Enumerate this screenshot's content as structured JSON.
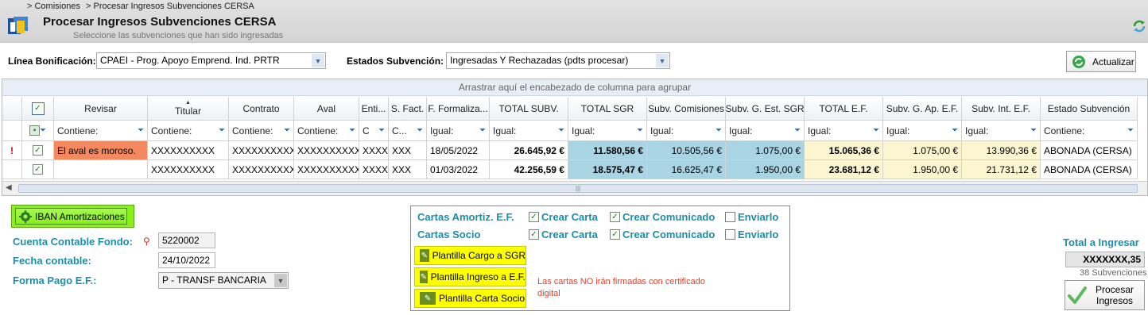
{
  "breadcrumb": {
    "item1": "> Comisiones",
    "item2": "> Procesar Ingresos Subvenciones CERSA"
  },
  "page": {
    "title": "Procesar Ingresos Subvenciones CERSA",
    "subtitle": "Seleccione las subvenciones que han sido ingresadas"
  },
  "filters": {
    "linea_label": "Línea Bonificación:",
    "linea_value": "CPAEI - Prog. Apoyo Emprend. Ind. PRTR",
    "estados_label": "Estados Subvención:",
    "estados_value": "Ingresadas Y Rechazadas (pdts procesar)",
    "actualizar_label": "Actualizar"
  },
  "grid": {
    "group_hint": "Arrastrar aquí el encabezado de columna para agrupar",
    "headers": [
      "Revisar",
      "Titular",
      "Contrato",
      "Aval",
      "Enti...",
      "S. Fact.",
      "F. Formaliza...",
      "TOTAL SUBV.",
      "TOTAL SGR",
      "Subv. Comisiones",
      "Subv. G. Est. SGR",
      "TOTAL E.F.",
      "Subv. G. Ap. E.F.",
      "Subv. Int. E.F.",
      "Estado Subvención"
    ],
    "filters": [
      "Contiene:",
      "Contiene:",
      "Contiene:",
      "Contiene:",
      "C",
      "C...",
      "Igual:",
      "Igual:",
      "Igual:",
      "Igual:",
      "Igual:",
      "Igual:",
      "Igual:",
      "Igual:",
      "Contiene:"
    ],
    "rows": [
      {
        "mark": "!",
        "revisar": "El aval es moroso.",
        "titular": "XXXXXXXXXX",
        "contrato": "XXXXXXXXXXXX",
        "aval": "XXXXXXXXXXXX",
        "enti": "XXXX",
        "sfact": "XXX",
        "fecha": "18/05/2022",
        "total_subv": "26.645,92 €",
        "total_sgr": "11.580,56 €",
        "subv_com": "10.505,56 €",
        "subv_gest": "1.075,00 €",
        "total_ef": "15.065,36 €",
        "subv_gap": "1.075,00 €",
        "subv_int": "13.990,36 €",
        "estado": "ABONADA (CERSA)"
      },
      {
        "mark": "",
        "revisar": "",
        "titular": "XXXXXXXXXX",
        "contrato": "XXXXXXXXXXXX",
        "aval": "XXXXXXXXXXXX",
        "enti": "XXXX",
        "sfact": "XXX",
        "fecha": "01/03/2022",
        "total_subv": "42.256,59 €",
        "total_sgr": "18.575,47 €",
        "subv_com": "16.625,47 €",
        "subv_gest": "1.950,00 €",
        "total_ef": "23.681,12 €",
        "subv_gap": "1.950,00 €",
        "subv_int": "21.731,12 €",
        "estado": "ABONADA (CERSA)"
      }
    ]
  },
  "bottom": {
    "iban_btn": "IBAN Amortizaciones",
    "cuenta_label": "Cuenta Contable Fondo:",
    "cuenta_value": "5220002",
    "fecha_label": "Fecha contable:",
    "fecha_value": "24/10/2022",
    "forma_label": "Forma Pago E.F.:",
    "forma_value": "P - TRANSF BANCARIA"
  },
  "cartas": {
    "amortiz_label": "Cartas Amortiz. E.F.",
    "socio_label": "Cartas Socio",
    "crear_carta": "Crear Carta",
    "crear_comunicado": "Crear Comunicado",
    "enviarlo": "Enviarlo",
    "btn_cargo": "Plantilla Cargo a SGR",
    "btn_ingreso": "Plantilla Ingreso a E.F.",
    "btn_socio": "Plantilla Carta Socio",
    "warning": "Las cartas NO irán firmadas con certificado digital"
  },
  "total": {
    "label": "Total a Ingresar",
    "value": "XXXXXXX,35",
    "count": "38 Subvenciones",
    "procesar": "Procesar Ingresos"
  },
  "colors": {
    "highlight_yellow": "#ffff00",
    "iban_green": "#88f01e",
    "row_orange": "#f4895f",
    "teal": "#1b8ea8",
    "sgr_blue": "#a8d4e4",
    "ef_yellow": "#fbf6cf"
  }
}
